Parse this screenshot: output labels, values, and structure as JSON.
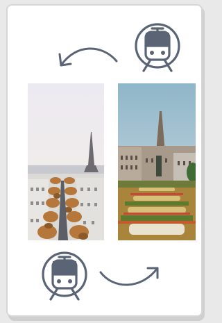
{
  "illustration": {
    "subject": "train-travel-between-cities",
    "icons": [
      "train-icon",
      "curved-arrow-left-icon",
      "curved-arrow-right-icon"
    ],
    "photos": [
      "paris-photo",
      "brussels-photo"
    ],
    "colors": {
      "icon_stroke": "#5b6475",
      "card_bg": "#ffffff",
      "card_border": "#d6d6d6",
      "page_bg": "#e9e9ea"
    }
  }
}
